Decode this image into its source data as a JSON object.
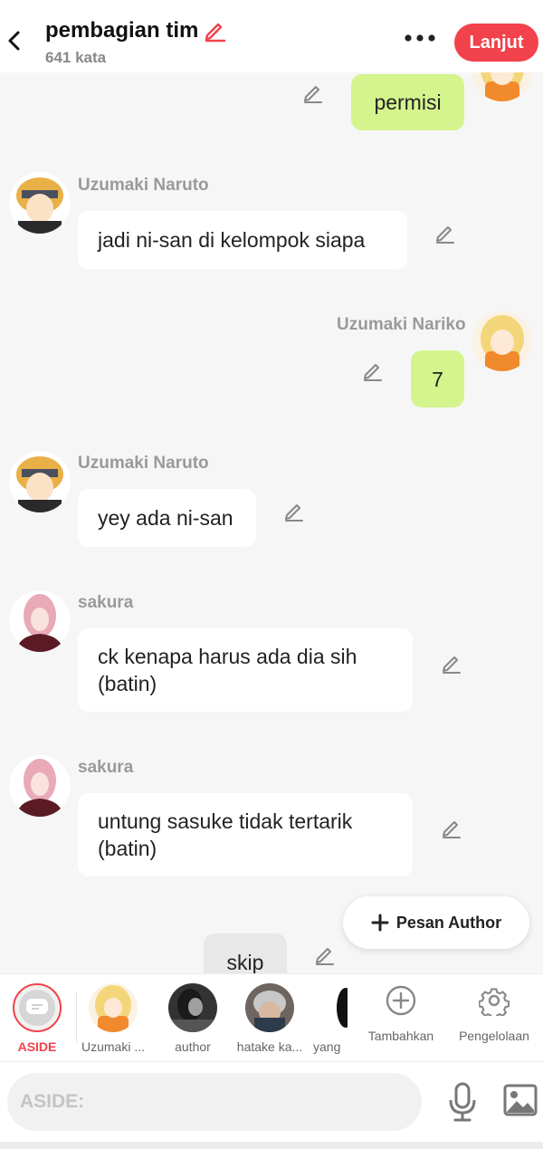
{
  "header": {
    "title": "pembagian tim",
    "word_count": "641 kata",
    "next_label": "Lanjut",
    "accent": "#f2424b"
  },
  "messages": [
    {
      "side": "right",
      "name": "",
      "text": "permisi",
      "avatar": "nariko"
    },
    {
      "side": "left",
      "name": "Uzumaki Naruto",
      "text": "jadi ni-san di kelompok  siapa",
      "avatar": "naruto"
    },
    {
      "side": "right",
      "name": "Uzumaki Nariko",
      "text": "7",
      "avatar": "nariko"
    },
    {
      "side": "left",
      "name": "Uzumaki Naruto",
      "text": "yey ada ni-san",
      "avatar": "naruto"
    },
    {
      "side": "left",
      "name": "sakura",
      "text": "ck kenapa harus ada dia sih (batin)",
      "avatar": "sakura"
    },
    {
      "side": "left",
      "name": "sakura",
      "text": "untung sasuke tidak tertarik (batin)",
      "avatar": "sakura"
    },
    {
      "side": "center",
      "name": "",
      "text": "skip"
    }
  ],
  "fab": {
    "label": "Pesan Author"
  },
  "characters": [
    {
      "label": "ASIDE",
      "selected": true
    },
    {
      "label": "Uzumaki ..."
    },
    {
      "label": "author"
    },
    {
      "label": "hatake ka..."
    },
    {
      "label": "yang"
    }
  ],
  "tools": {
    "add_label": "Tambahkan",
    "manage_label": "Pengelolaan"
  },
  "input": {
    "placeholder": "ASIDE:"
  },
  "colors": {
    "mine_bubble": "#d4f48e",
    "theirs_bubble": "#ffffff",
    "system_bubble": "#e8e8e8"
  }
}
